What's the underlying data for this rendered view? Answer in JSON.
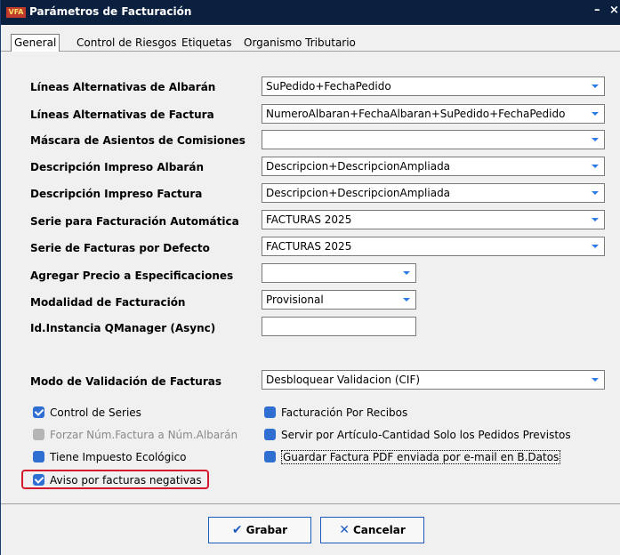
{
  "window": {
    "logo_text": "VFA",
    "title": "Parámetros de Facturación",
    "minimize": "–",
    "close": "×"
  },
  "tabs": [
    {
      "label": "General"
    },
    {
      "label": "Control de Riesgos"
    },
    {
      "label": "Etiquetas"
    },
    {
      "label": "Organismo Tributario"
    }
  ],
  "fields": [
    {
      "label": "Líneas Alternativas de Albarán",
      "value": "SuPedido+FechaPedido"
    },
    {
      "label": "Líneas Alternativas de Factura",
      "value": "NumeroAlbaran+FechaAlbaran+SuPedido+FechaPedido"
    },
    {
      "label": "Máscara de Asientos de Comisiones",
      "value": ""
    },
    {
      "label": "Descripción Impreso Albarán",
      "value": "Descripcion+DescripcionAmpliada"
    },
    {
      "label": "Descripción Impreso Factura",
      "value": "Descripcion+DescripcionAmpliada"
    },
    {
      "label": "Serie para Facturación Automática",
      "value": "FACTURAS 2025"
    },
    {
      "label": "Serie de Facturas por Defecto",
      "value": "FACTURAS 2025"
    },
    {
      "label": "Agregar Precio a Especificaciones",
      "value": ""
    },
    {
      "label": "Modalidad de Facturación",
      "value": "Provisional"
    },
    {
      "label": "Id.Instancia QManager (Async)",
      "value": ""
    },
    {
      "label": "Modo de Validación de Facturas",
      "value": "Desbloquear Validacion (CIF)"
    }
  ],
  "checks_left": [
    {
      "label": "Control de Series",
      "checked": true
    },
    {
      "label": "Forzar Núm.Factura a Núm.Albarán",
      "checked": false
    },
    {
      "label": "Tiene Impuesto Ecológico",
      "checked": false
    },
    {
      "label": "Aviso por facturas negativas",
      "checked": true
    }
  ],
  "checks_right": [
    {
      "label": "Facturación Por Recibos",
      "checked": false
    },
    {
      "label": "Servir por Artículo-Cantidad Solo los Pedidos Previstos",
      "checked": false
    },
    {
      "label": "Guardar Factura PDF enviada por e-mail en B.Datos",
      "checked": false
    }
  ],
  "buttons": {
    "save_label": "Grabar",
    "cancel_label": "Cancelar"
  },
  "colors": {
    "titlebar": "#0b1f3f",
    "accent": "#2f6fd1",
    "highlight": "#d61a2e"
  },
  "icons": {
    "save": "checkmark-icon",
    "cancel": "x-icon"
  }
}
